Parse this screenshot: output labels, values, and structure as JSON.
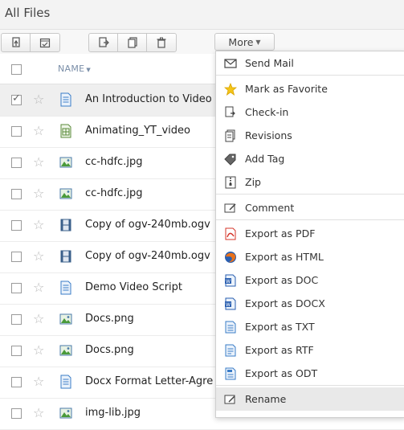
{
  "page": {
    "title": "All Files"
  },
  "toolbar": {
    "group1": [
      "upload-icon",
      "schedule-icon"
    ],
    "group2": [
      "move-icon",
      "copy-icon",
      "delete-icon"
    ],
    "more_label": "More"
  },
  "list": {
    "header_name": "NAME",
    "rows": [
      {
        "name": "An Introduction to Video Script",
        "icon": "document-icon",
        "checked": true
      },
      {
        "name": "Animating_YT_video",
        "icon": "spreadsheet-icon",
        "checked": false
      },
      {
        "name": "cc-hdfc.jpg",
        "icon": "image-icon",
        "checked": false
      },
      {
        "name": "cc-hdfc.jpg",
        "icon": "image-icon",
        "checked": false
      },
      {
        "name": "Copy of ogv-240mb.ogv",
        "icon": "video-icon",
        "checked": false
      },
      {
        "name": "Copy of ogv-240mb.ogv",
        "icon": "video-icon",
        "checked": false
      },
      {
        "name": "Demo Video Script",
        "icon": "document-icon",
        "checked": false
      },
      {
        "name": "Docs.png",
        "icon": "image-icon",
        "checked": false
      },
      {
        "name": "Docs.png",
        "icon": "image-icon",
        "checked": false
      },
      {
        "name": "Docx Format Letter-Agreement",
        "icon": "document-icon",
        "checked": false
      },
      {
        "name": "img-lib.jpg",
        "icon": "image-icon",
        "checked": false
      }
    ]
  },
  "menu": {
    "items": [
      {
        "label": "Send Mail",
        "icon": "mail-icon"
      },
      {
        "label": "Mark as Favorite",
        "icon": "star-icon"
      },
      {
        "label": "Check-in",
        "icon": "check-in-icon"
      },
      {
        "label": "Revisions",
        "icon": "revisions-icon"
      },
      {
        "label": "Add Tag",
        "icon": "tag-icon"
      },
      {
        "label": "Zip",
        "icon": "zip-icon"
      },
      {
        "label": "Comment",
        "icon": "comment-icon"
      },
      {
        "label": "Export as PDF",
        "icon": "pdf-icon"
      },
      {
        "label": "Export as HTML",
        "icon": "firefox-icon"
      },
      {
        "label": "Export as DOC",
        "icon": "doc-icon"
      },
      {
        "label": "Export as DOCX",
        "icon": "docx-icon"
      },
      {
        "label": "Export as TXT",
        "icon": "txt-icon"
      },
      {
        "label": "Export as RTF",
        "icon": "rtf-icon"
      },
      {
        "label": "Export as ODT",
        "icon": "odt-icon"
      },
      {
        "label": "Rename",
        "icon": "rename-icon"
      }
    ]
  },
  "colors": {
    "accent_blue": "#3a7cc7",
    "star_yellow": "#f5c518",
    "pdf_red": "#d6352a",
    "image_green": "#4a9a3a"
  }
}
